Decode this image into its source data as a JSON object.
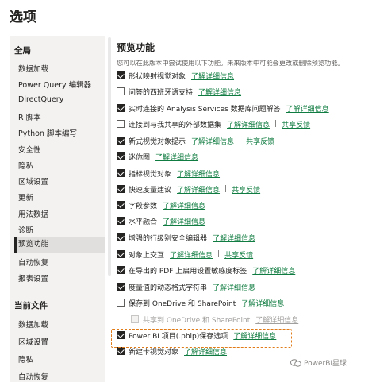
{
  "window": {
    "title": "选项"
  },
  "sidebar": {
    "sections": [
      {
        "header": "全局",
        "items": [
          "数据加载",
          "Power Query 编辑器",
          "DirectQuery",
          "R 脚本",
          "Python 脚本编写",
          "安全性",
          "隐私",
          "区域设置",
          "更新",
          "用法数据",
          "诊断",
          "预览功能",
          "自动恢复",
          "报表设置"
        ],
        "active": "预览功能"
      },
      {
        "header": "当前文件",
        "items": [
          "数据加载",
          "区域设置",
          "隐私",
          "自动恢复"
        ]
      }
    ]
  },
  "main": {
    "title": "预览功能",
    "description": "您可以在此版本中尝试使用以下功能。未来版本中可能会更改或删除预览功能。",
    "learn_more": "了解详细信息",
    "share_feedback": "共享反馈",
    "separator": "|",
    "features": [
      {
        "label": "形状映射视觉对象",
        "checked": true,
        "feedback": false
      },
      {
        "label": "问答的西班牙语支持",
        "checked": false,
        "feedback": false
      },
      {
        "label": "实时连接的 Analysis Services 数据库问题解答",
        "checked": true,
        "feedback": false
      },
      {
        "label": "连接到与我共享的外部数据集",
        "checked": false,
        "feedback": true
      },
      {
        "label": "新式视觉对象提示",
        "checked": true,
        "feedback": true
      },
      {
        "label": "迷你图",
        "checked": true,
        "feedback": false
      },
      {
        "label": "指标视觉对象",
        "checked": true,
        "feedback": false
      },
      {
        "label": "快速度量建议",
        "checked": true,
        "feedback": true
      },
      {
        "label": "字段参数",
        "checked": true,
        "feedback": false
      },
      {
        "label": "水平融合",
        "checked": true,
        "feedback": false
      },
      {
        "label": "增强的行级别安全编辑器",
        "checked": true,
        "feedback": false
      },
      {
        "label": "对象上交互",
        "checked": true,
        "feedback": true
      },
      {
        "label": "在导出的 PDF 上启用设置敏感度标签",
        "checked": true,
        "feedback": false
      },
      {
        "label": "度量值的动态格式字符串",
        "checked": true,
        "feedback": false
      },
      {
        "label": "保存到 OneDrive 和 SharePoint",
        "checked": false,
        "feedback": false
      },
      {
        "label": "共享到 OneDrive 和 SharePoint",
        "checked": false,
        "feedback": false,
        "disabled": true,
        "indent": true
      },
      {
        "label": "Power BI 项目(.pbip)保存选项",
        "checked": true,
        "feedback": false,
        "highlighted": true
      },
      {
        "label": "新建卡视觉对象",
        "checked": true,
        "feedback": false
      }
    ]
  },
  "watermark": {
    "text": "PowerBI星球"
  },
  "colors": {
    "link": "#107c41",
    "highlight_border": "#e07b17",
    "sidebar_bg": "#f3f2f1",
    "active_bg": "#e1dfdd"
  }
}
